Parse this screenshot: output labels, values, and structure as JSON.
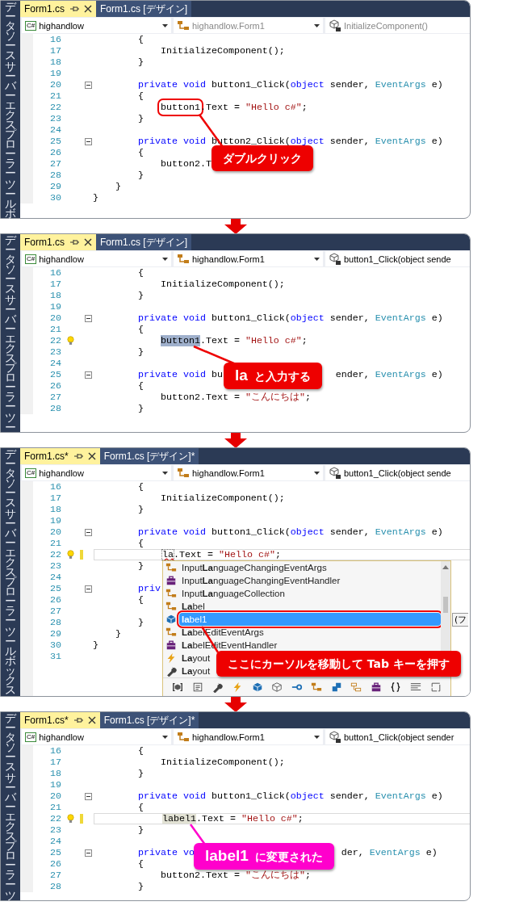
{
  "panels": [
    {
      "side_tabs": [
        "データソース",
        "サーバーエクスプローラー",
        "ツールボ"
      ],
      "tabs": [
        {
          "label": "Form1.cs",
          "selected": true
        },
        {
          "label": "Form1.cs [デザイン]",
          "selected": false
        }
      ],
      "combos": [
        {
          "kind": "project",
          "badge": "C#",
          "text": "highandlow",
          "disabled": false
        },
        {
          "kind": "class",
          "text": "highandlow.Form1",
          "disabled": true
        },
        {
          "kind": "member",
          "text": "InitializeComponent()",
          "disabled": true
        }
      ],
      "lines": [
        {
          "number": "16",
          "tokens": [
            {
              "text": "        {",
              "kind": "plain"
            }
          ],
          "fold": false,
          "lightbulb": false,
          "changed": false,
          "current": false
        },
        {
          "number": "17",
          "tokens": [
            {
              "text": "            InitializeComponent();",
              "kind": "plain"
            }
          ],
          "fold": false,
          "lightbulb": false,
          "changed": false,
          "current": false
        },
        {
          "number": "18",
          "tokens": [
            {
              "text": "        }",
              "kind": "plain"
            }
          ],
          "fold": false,
          "lightbulb": false,
          "changed": false,
          "current": false
        },
        {
          "number": "19",
          "fold": false,
          "lightbulb": false,
          "changed": false,
          "current": false
        },
        {
          "number": "20",
          "tokens": [
            {
              "text": "        private void",
              "kind": "keyword"
            },
            {
              "text": " button1_Click(",
              "kind": "plain"
            },
            {
              "text": "object",
              "kind": "keyword"
            },
            {
              "text": " sender, ",
              "kind": "plain"
            },
            {
              "text": "EventArgs",
              "kind": "type"
            },
            {
              "text": " e)",
              "kind": "plain"
            }
          ],
          "fold": true,
          "lightbulb": false,
          "changed": false,
          "current": false
        },
        {
          "number": "21",
          "tokens": [
            {
              "text": "        {",
              "kind": "plain"
            }
          ],
          "fold": false,
          "lightbulb": false,
          "changed": false,
          "current": false
        },
        {
          "number": "22",
          "tokens": [
            {
              "text": "            button1",
              "kind": "outlined"
            },
            {
              "text": ".Text = ",
              "kind": "plain"
            },
            {
              "text": "\"Hello c#\"",
              "kind": "string"
            },
            {
              "text": ";",
              "kind": "plain"
            }
          ],
          "fold": false,
          "lightbulb": false,
          "changed": false,
          "current": false
        },
        {
          "number": "23",
          "tokens": [
            {
              "text": "        }",
              "kind": "plain"
            }
          ],
          "fold": false,
          "lightbulb": false,
          "changed": false,
          "current": false
        },
        {
          "number": "24",
          "fold": false,
          "lightbulb": false,
          "changed": false,
          "current": false
        },
        {
          "number": "25",
          "tokens": [
            {
              "text": "        private void",
              "kind": "keyword"
            },
            {
              "text": " button2_Click(",
              "kind": "plain"
            },
            {
              "text": "object",
              "kind": "keyword"
            },
            {
              "text": " sender, ",
              "kind": "plain"
            },
            {
              "text": "EventArgs",
              "kind": "type"
            },
            {
              "text": " e)",
              "kind": "plain"
            }
          ],
          "fold": true,
          "lightbulb": false,
          "changed": false,
          "current": false
        },
        {
          "number": "26",
          "tokens": [
            {
              "text": "        {",
              "kind": "plain"
            }
          ],
          "fold": false,
          "lightbulb": false,
          "changed": false,
          "current": false
        },
        {
          "number": "27",
          "tokens": [
            {
              "text": "            button2.T",
              "kind": "plain"
            }
          ],
          "fold": false,
          "lightbulb": false,
          "changed": false,
          "current": false
        },
        {
          "number": "28",
          "tokens": [
            {
              "text": "        }",
              "kind": "plain"
            }
          ],
          "fold": false,
          "lightbulb": false,
          "changed": false,
          "current": false
        },
        {
          "number": "29",
          "tokens": [
            {
              "text": "    }",
              "kind": "plain"
            }
          ],
          "fold": false,
          "lightbulb": false,
          "changed": false,
          "current": false
        },
        {
          "number": "30",
          "tokens": [
            {
              "text": "}",
              "kind": "plain"
            }
          ],
          "fold": false,
          "lightbulb": false,
          "changed": false,
          "current": false
        }
      ],
      "callout": {
        "text": "ダブルクリック",
        "color": "#ee0000"
      }
    },
    {
      "side_tabs": [
        "データソース",
        "サーバーエクスプローラー",
        "ツー"
      ],
      "tabs": [
        {
          "label": "Form1.cs",
          "selected": true
        },
        {
          "label": "Form1.cs [デザイン]",
          "selected": false
        }
      ],
      "combos": [
        {
          "kind": "project",
          "badge": "C#",
          "text": "highandlow",
          "disabled": false
        },
        {
          "kind": "class",
          "text": "highandlow.Form1",
          "disabled": false
        },
        {
          "kind": "member",
          "text": "button1_Click(object sende",
          "disabled": false
        }
      ],
      "lines": [
        {
          "number": "16",
          "tokens": [
            {
              "text": "        {",
              "kind": "plain"
            }
          ],
          "fold": false,
          "lightbulb": false,
          "changed": false,
          "current": false
        },
        {
          "number": "17",
          "tokens": [
            {
              "text": "            InitializeComponent();",
              "kind": "plain"
            }
          ],
          "fold": false,
          "lightbulb": false,
          "changed": false,
          "current": false
        },
        {
          "number": "18",
          "tokens": [
            {
              "text": "        }",
              "kind": "plain"
            }
          ],
          "fold": false,
          "lightbulb": false,
          "changed": false,
          "current": false
        },
        {
          "number": "19",
          "fold": false,
          "lightbulb": false,
          "changed": false,
          "current": false
        },
        {
          "number": "20",
          "tokens": [
            {
              "text": "        private void",
              "kind": "keyword"
            },
            {
              "text": " button1_Click(",
              "kind": "plain"
            },
            {
              "text": "object",
              "kind": "keyword"
            },
            {
              "text": " sender, ",
              "kind": "plain"
            },
            {
              "text": "EventArgs",
              "kind": "type"
            },
            {
              "text": " e)",
              "kind": "plain"
            }
          ],
          "fold": true,
          "lightbulb": false,
          "changed": false,
          "current": false
        },
        {
          "number": "21",
          "tokens": [
            {
              "text": "        {",
              "kind": "plain"
            }
          ],
          "fold": false,
          "lightbulb": false,
          "changed": false,
          "current": false
        },
        {
          "number": "22",
          "tokens": [
            {
              "text": "            button1",
              "kind": "selection"
            },
            {
              "text": ".Text = ",
              "kind": "plain"
            },
            {
              "text": "\"Hello c#\"",
              "kind": "string"
            },
            {
              "text": ";",
              "kind": "plain"
            }
          ],
          "fold": false,
          "lightbulb": true,
          "changed": false,
          "current": false
        },
        {
          "number": "23",
          "tokens": [
            {
              "text": "        }",
              "kind": "plain"
            }
          ],
          "fold": false,
          "lightbulb": false,
          "changed": false,
          "current": false
        },
        {
          "number": "24",
          "fold": false,
          "lightbulb": false,
          "changed": false,
          "current": false
        },
        {
          "number": "25",
          "tokens": [
            {
              "text": "        private void",
              "kind": "keyword"
            },
            {
              "text": " bu",
              "kind": "plain"
            },
            {
              "text": "                    ender, ",
              "kind": "plain"
            },
            {
              "text": "EventArgs",
              "kind": "type"
            },
            {
              "text": " e)",
              "kind": "plain"
            }
          ],
          "fold": true,
          "lightbulb": false,
          "changed": false,
          "current": false
        },
        {
          "number": "26",
          "tokens": [
            {
              "text": "        {",
              "kind": "plain"
            }
          ],
          "fold": false,
          "lightbulb": false,
          "changed": false,
          "current": false
        },
        {
          "number": "27",
          "tokens": [
            {
              "text": "            button2.Text = ",
              "kind": "plain"
            },
            {
              "text": "\"こんにちは\"",
              "kind": "string"
            },
            {
              "text": ";",
              "kind": "plain"
            }
          ],
          "fold": false,
          "lightbulb": false,
          "changed": false,
          "current": false
        },
        {
          "number": "28",
          "tokens": [
            {
              "text": "        }",
              "kind": "plain"
            }
          ],
          "fold": false,
          "lightbulb": false,
          "changed": false,
          "current": false
        }
      ],
      "callout": {
        "emphasis": "la",
        "text": "と入力する",
        "color": "#ee0000"
      }
    },
    {
      "side_tabs": [
        "データソース",
        "サーバーエクスプローラー",
        "ツールボックス"
      ],
      "tabs": [
        {
          "label": "Form1.cs*",
          "selected": true
        },
        {
          "label": "Form1.cs [デザイン]*",
          "selected": false
        }
      ],
      "combos": [
        {
          "kind": "project",
          "badge": "C#",
          "text": "highandlow",
          "disabled": false
        },
        {
          "kind": "class",
          "text": "highandlow.Form1",
          "disabled": false
        },
        {
          "kind": "member",
          "text": "button1_Click(object sende",
          "disabled": false
        }
      ],
      "lines": [
        {
          "number": "16",
          "tokens": [
            {
              "text": "        {",
              "kind": "plain"
            }
          ],
          "fold": false,
          "lightbulb": false,
          "changed": false,
          "current": false
        },
        {
          "number": "17",
          "tokens": [
            {
              "text": "            InitializeComponent();",
              "kind": "plain"
            }
          ],
          "fold": false,
          "lightbulb": false,
          "changed": false,
          "current": false
        },
        {
          "number": "18",
          "tokens": [
            {
              "text": "        }",
              "kind": "plain"
            }
          ],
          "fold": false,
          "lightbulb": false,
          "changed": false,
          "current": false
        },
        {
          "number": "19",
          "fold": false,
          "lightbulb": false,
          "changed": false,
          "current": false
        },
        {
          "number": "20",
          "tokens": [
            {
              "text": "        private void",
              "kind": "keyword"
            },
            {
              "text": " button1_Click(",
              "kind": "plain"
            },
            {
              "text": "object",
              "kind": "keyword"
            },
            {
              "text": " sender, ",
              "kind": "plain"
            },
            {
              "text": "EventArgs",
              "kind": "type"
            },
            {
              "text": " e)",
              "kind": "plain"
            }
          ],
          "fold": true,
          "lightbulb": false,
          "changed": false,
          "current": false
        },
        {
          "number": "21",
          "tokens": [
            {
              "text": "        {",
              "kind": "plain"
            }
          ],
          "fold": false,
          "lightbulb": false,
          "changed": false,
          "current": false
        },
        {
          "number": "22",
          "tokens": [
            {
              "text": "            la",
              "kind": "squiggle"
            },
            {
              "text": ".Text = ",
              "kind": "plain"
            },
            {
              "text": "\"Hello c#\"",
              "kind": "string"
            },
            {
              "text": ";",
              "kind": "plain"
            }
          ],
          "fold": false,
          "lightbulb": true,
          "changed": true,
          "current": true
        },
        {
          "number": "23",
          "tokens": [
            {
              "text": "        }",
              "kind": "plain"
            }
          ],
          "fold": false,
          "lightbulb": false,
          "changed": false,
          "current": false
        },
        {
          "number": "24",
          "fold": false,
          "lightbulb": false,
          "changed": false,
          "current": false
        },
        {
          "number": "25",
          "tokens": [
            {
              "text": "        priv",
              "kind": "keyword"
            }
          ],
          "fold": true,
          "lightbulb": false,
          "changed": false,
          "current": false
        },
        {
          "number": "26",
          "tokens": [
            {
              "text": "        {",
              "kind": "plain"
            }
          ],
          "fold": false,
          "lightbulb": false,
          "changed": false,
          "current": false
        },
        {
          "number": "27",
          "fold": false,
          "lightbulb": false,
          "changed": false,
          "current": false
        },
        {
          "number": "28",
          "tokens": [
            {
              "text": "        }",
              "kind": "plain"
            }
          ],
          "fold": false,
          "lightbulb": false,
          "changed": false,
          "current": false
        },
        {
          "number": "29",
          "tokens": [
            {
              "text": "    }",
              "kind": "plain"
            }
          ],
          "fold": false,
          "lightbulb": false,
          "changed": false,
          "current": false
        },
        {
          "number": "30",
          "tokens": [
            {
              "text": "}",
              "kind": "plain"
            }
          ],
          "fold": false,
          "lightbulb": false,
          "changed": false,
          "current": false
        },
        {
          "number": "31",
          "fold": false,
          "lightbulb": false,
          "changed": false,
          "current": false
        }
      ],
      "completion": {
        "items": [
          {
            "label": "Input**La**nguageChangingEventArgs",
            "kind": "class",
            "selected": false,
            "outlined": false
          },
          {
            "label": "Input**La**nguageChangingEventHandler",
            "kind": "delegate",
            "selected": false,
            "outlined": false
          },
          {
            "label": "Input**La**nguageCollection",
            "kind": "class",
            "selected": false,
            "outlined": false
          },
          {
            "label": "**La**bel",
            "kind": "class",
            "selected": false,
            "outlined": false
          },
          {
            "label": "**la**bel1",
            "kind": "field",
            "selected": true,
            "outlined": true
          },
          {
            "label": "**La**belEditEventArgs",
            "kind": "class",
            "selected": false,
            "outlined": false
          },
          {
            "label": "**La**belEditEventHandler",
            "kind": "delegate",
            "selected": false,
            "outlined": false
          },
          {
            "label": "**La**yout",
            "kind": "event",
            "selected": false,
            "outlined": false
          },
          {
            "label": "**La**yout",
            "kind": "property",
            "selected": false,
            "outlined": false
          }
        ],
        "tooltip": "(フ"
      },
      "callout": {
        "text": "ここにカーソルを移動して Tab キーを押す",
        "color": "#ee0000"
      }
    },
    {
      "side_tabs": [
        "データソース",
        "サーバーエクスプローラー",
        "ツ"
      ],
      "tabs": [
        {
          "label": "Form1.cs*",
          "selected": true
        },
        {
          "label": "Form1.cs [デザイン]*",
          "selected": false
        }
      ],
      "combos": [
        {
          "kind": "project",
          "badge": "C#",
          "text": "highandlow",
          "disabled": false
        },
        {
          "kind": "class",
          "text": "highandlow.Form1",
          "disabled": false
        },
        {
          "kind": "member",
          "text": "button1_Click(object sender",
          "disabled": false
        }
      ],
      "lines": [
        {
          "number": "16",
          "tokens": [
            {
              "text": "        {",
              "kind": "plain"
            }
          ],
          "fold": false,
          "lightbulb": false,
          "changed": false,
          "current": false
        },
        {
          "number": "17",
          "tokens": [
            {
              "text": "            InitializeComponent();",
              "kind": "plain"
            }
          ],
          "fold": false,
          "lightbulb": false,
          "changed": false,
          "current": false
        },
        {
          "number": "18",
          "tokens": [
            {
              "text": "        }",
              "kind": "plain"
            }
          ],
          "fold": false,
          "lightbulb": false,
          "changed": false,
          "current": false
        },
        {
          "number": "19",
          "fold": false,
          "lightbulb": false,
          "changed": false,
          "current": false
        },
        {
          "number": "20",
          "tokens": [
            {
              "text": "        private void",
              "kind": "keyword"
            },
            {
              "text": " button1_Click(",
              "kind": "plain"
            },
            {
              "text": "object",
              "kind": "keyword"
            },
            {
              "text": " sender, ",
              "kind": "plain"
            },
            {
              "text": "EventArgs",
              "kind": "type"
            },
            {
              "text": " e)",
              "kind": "plain"
            }
          ],
          "fold": true,
          "lightbulb": false,
          "changed": false,
          "current": false
        },
        {
          "number": "21",
          "tokens": [
            {
              "text": "        {",
              "kind": "plain"
            }
          ],
          "fold": false,
          "lightbulb": false,
          "changed": false,
          "current": false
        },
        {
          "number": "22",
          "tokens": [
            {
              "text": "            label1",
              "kind": "reference"
            },
            {
              "text": ".Text = ",
              "kind": "plain"
            },
            {
              "text": "\"Hello c#\"",
              "kind": "string"
            },
            {
              "text": ";",
              "kind": "plain"
            }
          ],
          "fold": false,
          "lightbulb": true,
          "changed": true,
          "current": true
        },
        {
          "number": "23",
          "tokens": [
            {
              "text": "        }",
              "kind": "plain"
            }
          ],
          "fold": false,
          "lightbulb": false,
          "changed": false,
          "current": false
        },
        {
          "number": "24",
          "fold": false,
          "lightbulb": false,
          "changed": false,
          "current": false
        },
        {
          "number": "25",
          "tokens": [
            {
              "text": "        private vo",
              "kind": "keyword"
            },
            {
              "text": "                          der, ",
              "kind": "plain"
            },
            {
              "text": "EventArgs",
              "kind": "type"
            },
            {
              "text": " e)",
              "kind": "plain"
            }
          ],
          "fold": true,
          "lightbulb": false,
          "changed": false,
          "current": false
        },
        {
          "number": "26",
          "tokens": [
            {
              "text": "        {",
              "kind": "plain"
            }
          ],
          "fold": false,
          "lightbulb": false,
          "changed": false,
          "current": false
        },
        {
          "number": "27",
          "tokens": [
            {
              "text": "            button2.Text = ",
              "kind": "plain"
            },
            {
              "text": "\"こんにちは\"",
              "kind": "string"
            },
            {
              "text": ";",
              "kind": "plain"
            }
          ],
          "fold": false,
          "lightbulb": false,
          "changed": false,
          "current": false
        },
        {
          "number": "28",
          "tokens": [
            {
              "text": "        }",
              "kind": "plain"
            }
          ],
          "fold": false,
          "lightbulb": false,
          "changed": false,
          "current": false
        }
      ],
      "callout": {
        "emphasis": "label1",
        "text": "に変更された",
        "color": "#ff00cc"
      }
    }
  ]
}
